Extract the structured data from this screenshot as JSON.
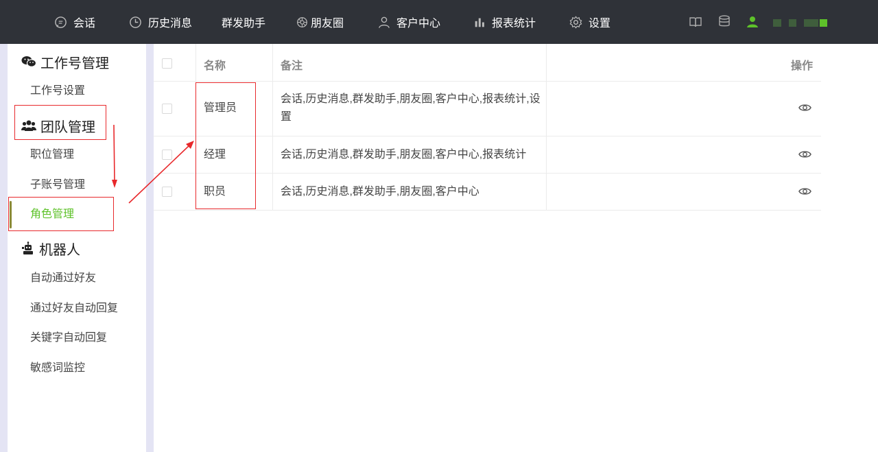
{
  "nav": {
    "items": [
      {
        "label": "会话",
        "icon": "chat-icon"
      },
      {
        "label": "历史消息",
        "icon": "clock-icon"
      },
      {
        "label": "群发助手",
        "icon": ""
      },
      {
        "label": "朋友圈",
        "icon": "aperture-icon"
      },
      {
        "label": "客户中心",
        "icon": "user-icon"
      },
      {
        "label": "报表统计",
        "icon": "bar-chart-icon"
      },
      {
        "label": "设置",
        "icon": "gear-icon"
      }
    ],
    "right_icons": [
      "book-icon",
      "database-icon",
      "user-online-icon"
    ],
    "accent_color": "#5ec22a"
  },
  "sidebar": {
    "groups": [
      {
        "title": "工作号管理",
        "icon": "wechat-icon",
        "items": [
          "工作号设置"
        ]
      },
      {
        "title": "团队管理",
        "icon": "team-icon",
        "items": [
          "职位管理",
          "子账号管理",
          "角色管理"
        ]
      },
      {
        "title": "机器人",
        "icon": "robot-icon",
        "items": [
          "自动通过好友",
          "通过好友自动回复",
          "关键字自动回复",
          "敏感词监控"
        ]
      }
    ],
    "active_item": "角色管理"
  },
  "table": {
    "headers": {
      "name": "名称",
      "remark": "备注",
      "action": "操作"
    },
    "rows": [
      {
        "name": "管理员",
        "remark_line1": "会话,历史消息,群发助手,朋友圈,客户中心,报表统计,设",
        "remark_line2": "置"
      },
      {
        "name": "经理",
        "remark_line1": "会话,历史消息,群发助手,朋友圈,客户中心,报表统计",
        "remark_line2": ""
      },
      {
        "name": "职员",
        "remark_line1": "会话,历史消息,群发助手,朋友圈,客户中心",
        "remark_line2": ""
      }
    ]
  }
}
